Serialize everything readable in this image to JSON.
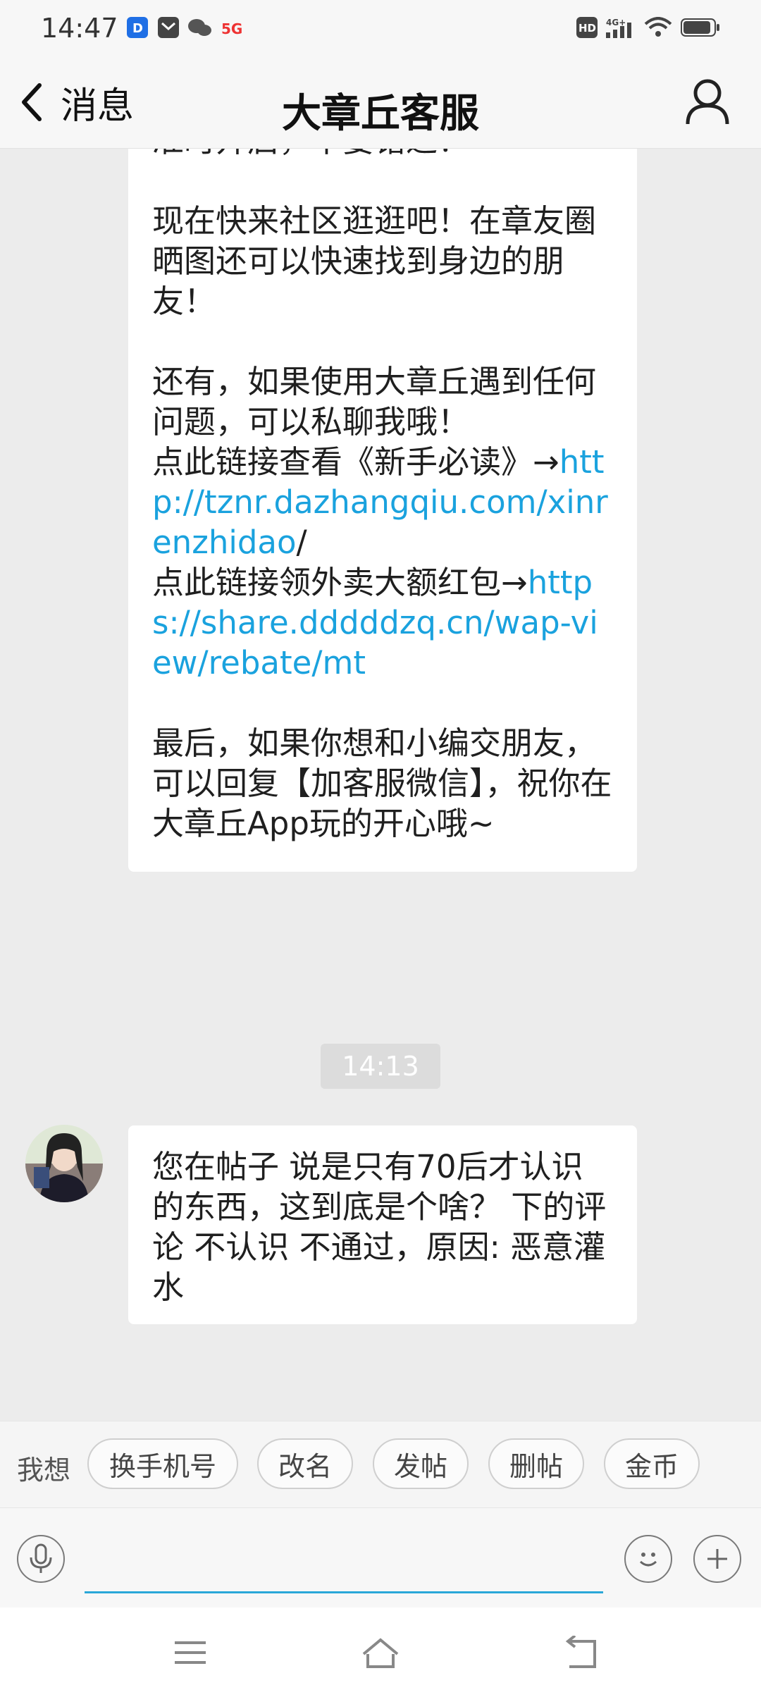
{
  "status_bar": {
    "time": "14:47",
    "indicators": [
      "dingtalk-icon",
      "mail-icon",
      "wechat-icon",
      "5g-icon",
      "hd-icon",
      "4g-signal-icon",
      "wifi-icon",
      "battery-icon"
    ]
  },
  "nav": {
    "back_label": "消息",
    "title": "大章丘客服"
  },
  "messages": {
    "top_bubble": {
      "cut_line": "准时开启，不要错过！",
      "para1": "现在快来社区逛逛吧！在章友圈晒图还可以快速找到身边的朋友！",
      "para2": "还有，如果使用大章丘遇到任何问题，可以私聊我哦！",
      "link1_prefix": "点此链接查看《新手必读》→",
      "link1": "http://tznr.dazhangqiu.com/xinrenzhidao",
      "link1_suffix": "/",
      "link2_prefix": "点此链接领外卖大额红包→",
      "link2": "https://share.dddddzq.cn/wap-view/rebate/mt",
      "para3": "最后，如果你想和小编交朋友，可以回复【加客服微信】，祝你在大章丘App玩的开心哦~"
    },
    "timestamp": "14:13",
    "bottom_bubble": {
      "text": "您在帖子 说是只有70后才认识的东西，这到底是个啥？ 下的评论 不认识 不通过，原因: 恶意灌水"
    }
  },
  "quick_replies": {
    "label": "我想",
    "items": [
      "换手机号",
      "改名",
      "发帖",
      "删帖",
      "金币"
    ]
  },
  "input": {
    "placeholder": ""
  },
  "colors": {
    "link": "#1aa2de",
    "background": "#ececec",
    "input_underline": "#2aa7d8"
  }
}
